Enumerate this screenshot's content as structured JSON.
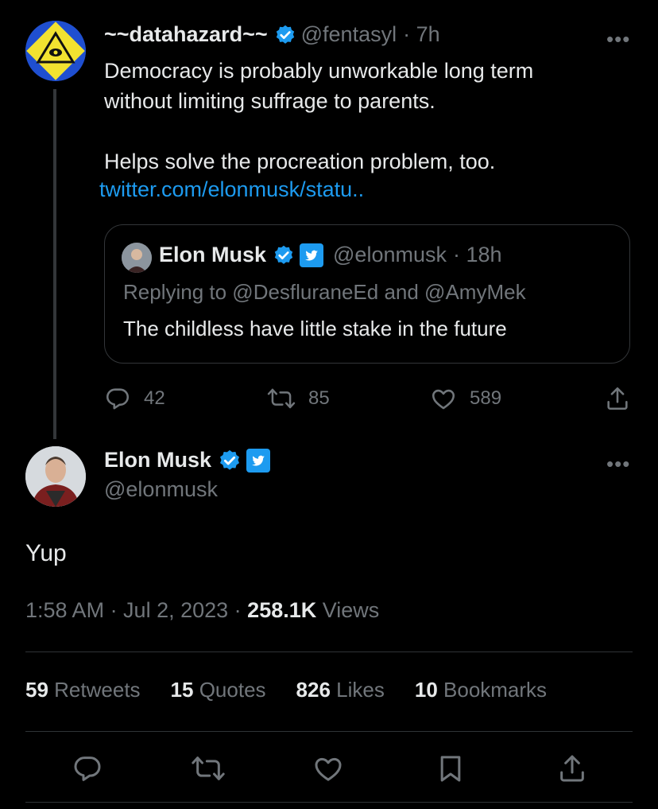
{
  "parent": {
    "display_name": "~~datahazard~~",
    "handle": "@fentasyl",
    "time": "· 7h",
    "text_line1": "Democracy is probably unworkable long term",
    "text_line2": "without limiting suffrage to parents.",
    "text_line3": "Helps solve the procreation problem, too.",
    "link": "twitter.com/elonmusk/statu..",
    "more": "•••",
    "quote": {
      "display_name": "Elon Musk",
      "handle": "@elonmusk",
      "time": "· 18h",
      "replying_to": "Replying to @DesfluraneEd and @AmyMek",
      "text": "The childless have little stake in the future"
    },
    "actions": {
      "replies": "42",
      "retweets": "85",
      "likes": "589"
    }
  },
  "tweet": {
    "display_name": "Elon Musk",
    "handle": "@elonmusk",
    "more": "•••",
    "body": "Yup",
    "time": "1:58 AM · Jul 2, 2023 ·",
    "views_count": "258.1K",
    "views_label": "Views",
    "stats": {
      "retweets_count": "59",
      "retweets_label": "Retweets",
      "quotes_count": "15",
      "quotes_label": "Quotes",
      "likes_count": "826",
      "likes_label": "Likes",
      "bookmarks_count": "10",
      "bookmarks_label": "Bookmarks"
    }
  },
  "colors": {
    "background": "#000000",
    "text": "#e7e9ea",
    "muted": "#71767b",
    "link": "#1d9bf0",
    "verified": "#1d9bf0"
  },
  "icons": [
    "verified-badge-icon",
    "twitter-bird-icon",
    "reply-icon",
    "retweet-icon",
    "like-icon",
    "share-icon",
    "bookmark-icon",
    "more-icon"
  ]
}
